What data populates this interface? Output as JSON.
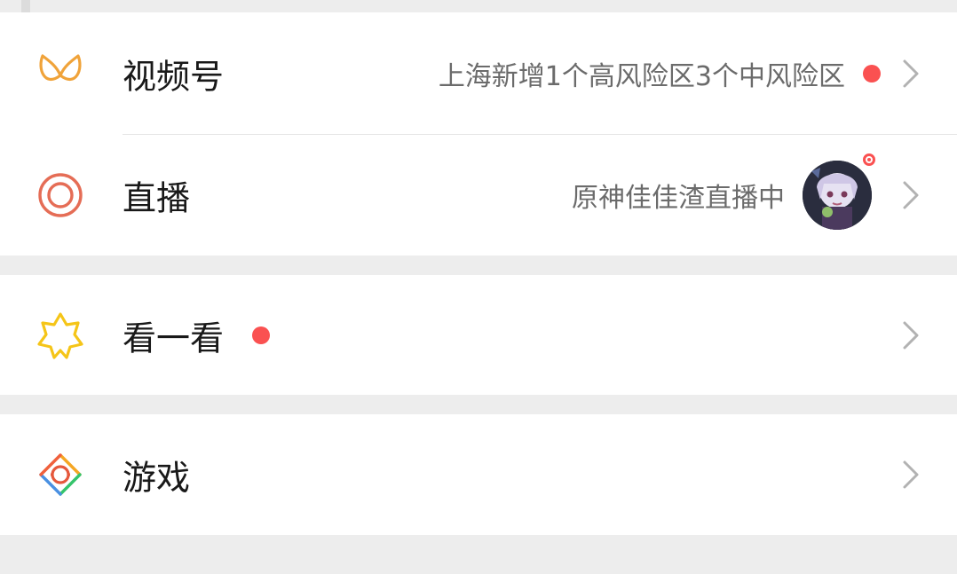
{
  "rows": {
    "channels": {
      "title": "视频号",
      "subtitle": "上海新增1个高风险区3个中风险区"
    },
    "live": {
      "title": "直播",
      "subtitle": "原神佳佳渣直播中"
    },
    "top_stories": {
      "title": "看一看"
    },
    "games": {
      "title": "游戏"
    }
  },
  "icons": {
    "channels": "channels-butterfly-icon",
    "live": "live-circle-icon",
    "top_stories": "top-stories-star-icon",
    "games": "games-diamond-icon",
    "chevron": "chevron-right-icon"
  },
  "colors": {
    "background": "#ededed",
    "card": "#ffffff",
    "badge_red": "#fa5151",
    "channels_orange": "#f0a33a",
    "live_red": "#e56d56",
    "stories_yellow": "#f5c518",
    "title_text": "#191919",
    "subtitle_text": "#6b6b6b"
  }
}
